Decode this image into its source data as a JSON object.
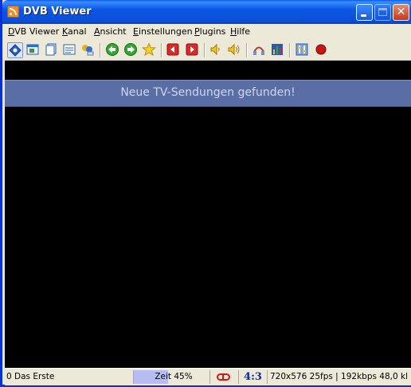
{
  "window": {
    "title": "DVB Viewer"
  },
  "menu": [
    {
      "prefix": "",
      "underline": "D",
      "suffix": "VB Viewer"
    },
    {
      "prefix": "",
      "underline": "K",
      "suffix": "anal"
    },
    {
      "prefix": "",
      "underline": "A",
      "suffix": "nsicht"
    },
    {
      "prefix": "",
      "underline": "E",
      "suffix": "instellungen"
    },
    {
      "prefix": "",
      "underline": "P",
      "suffix": "lugins"
    },
    {
      "prefix": "",
      "underline": "H",
      "suffix": "ilfe"
    }
  ],
  "toolbar": {
    "icons": [
      "tv-mode-icon",
      "window-icon",
      "pages-icon",
      "teletext-icon",
      "epg-icon",
      "back-icon",
      "forward-icon",
      "favorites-star-icon",
      "previous-channel-icon",
      "next-channel-icon",
      "volume-down-icon",
      "volume-up-icon",
      "audio-icon",
      "equalizer-icon",
      "settings-icon",
      "record-icon"
    ]
  },
  "osd": {
    "message": "Neue TV-Sendungen gefunden!"
  },
  "status": {
    "channel": "0 Das Erste",
    "time_label": "Zeit 45%",
    "time_progress": 0.45,
    "aspect": "4:3",
    "stream_info": "720x576 25fps | 192kbps 48,0 kl"
  },
  "colors": {
    "titlebar": "#0a4fd6",
    "osd_banner": "#5a6ea6",
    "progress": "#b7bcf2",
    "aspect_text": "#0a2bb0",
    "record": "#d01818"
  }
}
